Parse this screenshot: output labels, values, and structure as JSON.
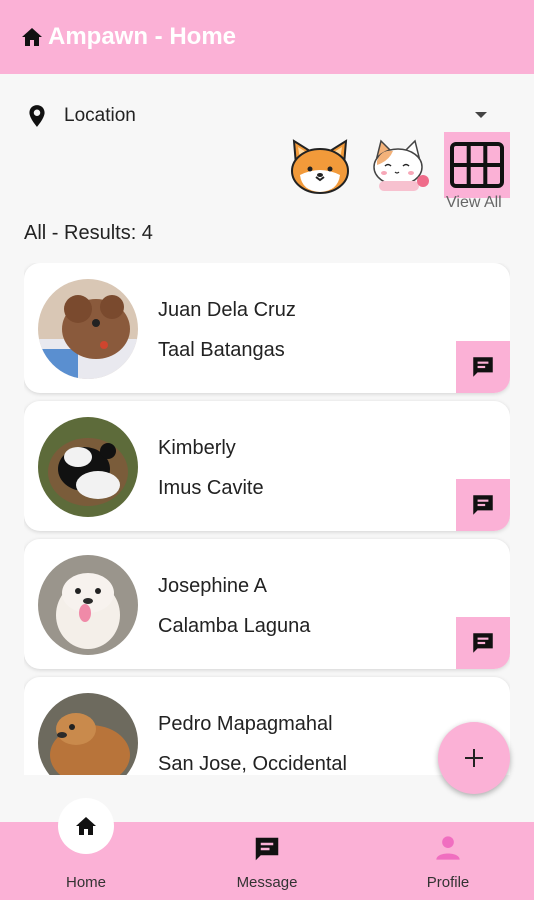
{
  "app_bar": {
    "title": "Ampawn - Home",
    "icon": "home-icon"
  },
  "location": {
    "label": "Location",
    "icon": "location-pin-icon"
  },
  "categories": {
    "items": [
      {
        "name": "dog",
        "icon": "shiba-dog-icon"
      },
      {
        "name": "cat",
        "icon": "cat-icon"
      },
      {
        "name": "all",
        "icon": "grid-icon",
        "selected": true
      }
    ],
    "view_all_label": "View All"
  },
  "results_text": "All - Results: 4",
  "listings": [
    {
      "name": "Juan Dela Cruz",
      "location": "Taal Batangas"
    },
    {
      "name": "Kimberly",
      "location": "Imus Cavite"
    },
    {
      "name": "Josephine A",
      "location": "Calamba Laguna"
    },
    {
      "name": "Pedro Mapagmahal",
      "location": "San Jose, Occidental Mindoro"
    }
  ],
  "fab": {
    "label": "+"
  },
  "bottom_nav": {
    "items": [
      {
        "label": "Home",
        "icon": "home-icon",
        "active": true
      },
      {
        "label": "Message",
        "icon": "message-icon"
      },
      {
        "label": "Profile",
        "icon": "person-icon"
      }
    ]
  },
  "colors": {
    "accent": "#fbb1d6",
    "nav_active_icon": "#000000",
    "profile_icon": "#f06ec0"
  }
}
